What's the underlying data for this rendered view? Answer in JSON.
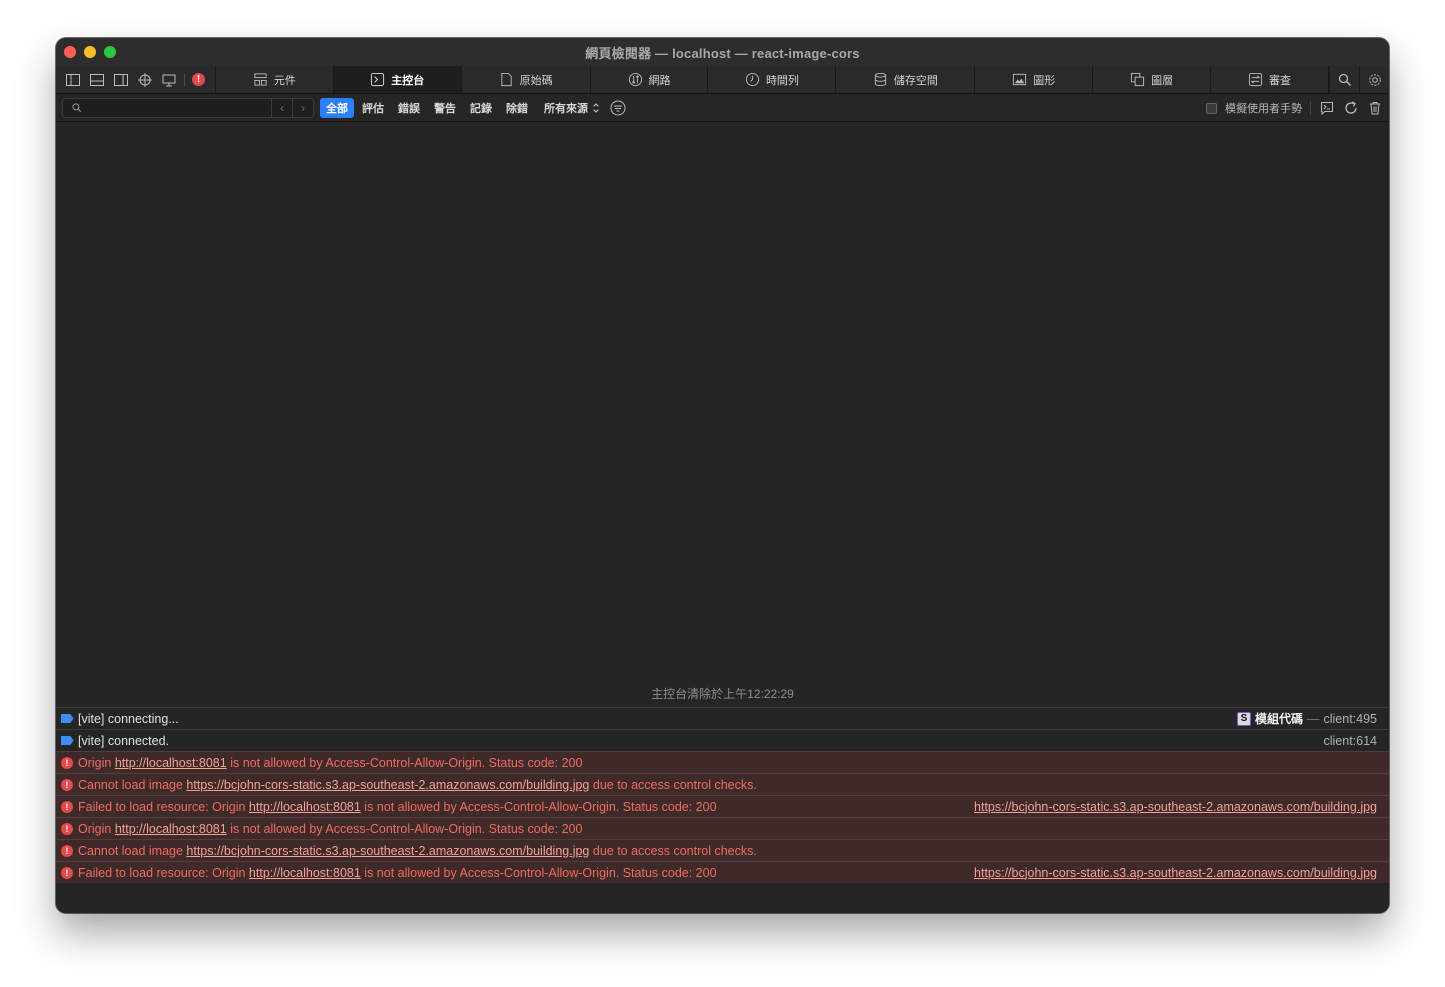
{
  "window": {
    "title": "網頁檢閱器 — localhost — react-image-cors"
  },
  "tabs": [
    {
      "label": "元件",
      "icon": "elements-icon"
    },
    {
      "label": "主控台",
      "icon": "console-icon"
    },
    {
      "label": "原始碼",
      "icon": "sources-icon"
    },
    {
      "label": "網路",
      "icon": "network-icon"
    },
    {
      "label": "時間列",
      "icon": "timelines-icon"
    },
    {
      "label": "儲存空間",
      "icon": "storage-icon"
    },
    {
      "label": "圖形",
      "icon": "graphics-icon"
    },
    {
      "label": "圖層",
      "icon": "layers-icon"
    },
    {
      "label": "審查",
      "icon": "audit-icon"
    }
  ],
  "active_tab": "主控台",
  "filterbar": {
    "search_placeholder": "",
    "levels": [
      "全部",
      "評估",
      "錯誤",
      "警告",
      "記錄",
      "除錯"
    ],
    "active_level": "全部",
    "sources_label": "所有來源",
    "simulate_gesture_label": "模擬使用者手勢"
  },
  "console": {
    "cleared_notice": "主控台清除於上午12:22:29",
    "module_label": "模組代碼",
    "module_badge": "S",
    "messages": [
      {
        "type": "log",
        "parts": [
          {
            "t": "[vite] connecting..."
          }
        ],
        "source": "client:495"
      },
      {
        "type": "log",
        "parts": [
          {
            "t": "[vite] connected."
          }
        ],
        "source": "client:614"
      },
      {
        "type": "error",
        "parts": [
          {
            "t": "Origin "
          },
          {
            "t": "http://localhost:8081",
            "link": true
          },
          {
            "t": " is not allowed by Access-Control-Allow-Origin. Status code: 200"
          }
        ],
        "source": ""
      },
      {
        "type": "error",
        "parts": [
          {
            "t": "Cannot load image "
          },
          {
            "t": "https://bcjohn-cors-static.s3.ap-southeast-2.amazonaws.com/building.jpg",
            "link": true
          },
          {
            "t": " due to access control checks."
          }
        ],
        "source": ""
      },
      {
        "type": "error",
        "parts": [
          {
            "t": "Failed to load resource: Origin "
          },
          {
            "t": "http://localhost:8081",
            "link": true
          },
          {
            "t": " is not allowed by Access-Control-Allow-Origin. Status code: 200"
          }
        ],
        "source": "https://bcjohn-cors-static.s3.ap-southeast-2.amazonaws.com/building.jpg"
      },
      {
        "type": "error",
        "parts": [
          {
            "t": "Origin "
          },
          {
            "t": "http://localhost:8081",
            "link": true
          },
          {
            "t": " is not allowed by Access-Control-Allow-Origin. Status code: 200"
          }
        ],
        "source": ""
      },
      {
        "type": "error",
        "parts": [
          {
            "t": "Cannot load image "
          },
          {
            "t": "https://bcjohn-cors-static.s3.ap-southeast-2.amazonaws.com/building.jpg",
            "link": true
          },
          {
            "t": " due to access control checks."
          }
        ],
        "source": ""
      },
      {
        "type": "error",
        "parts": [
          {
            "t": "Failed to load resource: Origin "
          },
          {
            "t": "http://localhost:8081",
            "link": true
          },
          {
            "t": " is not allowed by Access-Control-Allow-Origin. Status code: 200"
          }
        ],
        "source": "https://bcjohn-cors-static.s3.ap-southeast-2.amazonaws.com/building.jpg"
      }
    ],
    "prompt_symbol": "›"
  },
  "colors": {
    "accent": "#2d7ff9",
    "error_text": "#f16b5f",
    "error_bg": "#3e2a29",
    "log_icon": "#3f8cf6"
  }
}
